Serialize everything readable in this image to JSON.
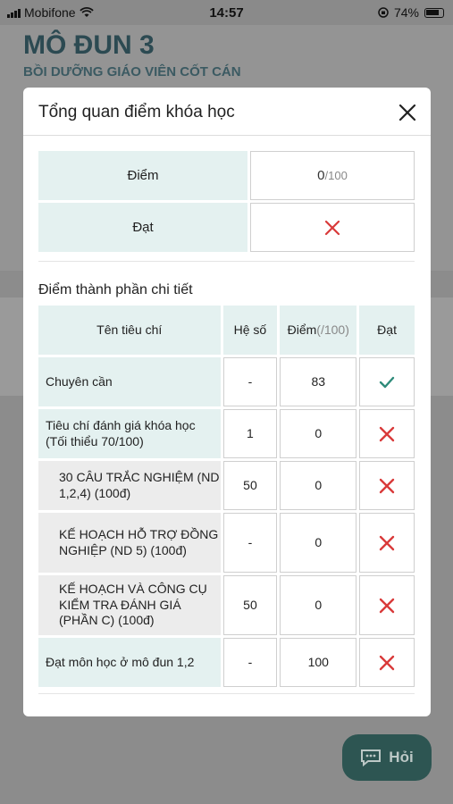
{
  "status_bar": {
    "carrier": "Mobifone",
    "time": "14:57",
    "battery": "74%"
  },
  "background": {
    "title": "MÔ ĐUN 3",
    "subtitle": "BỒI DƯỠNG GIÁO VIÊN CỐT CÁN",
    "chat_button": "Hỏi"
  },
  "modal": {
    "title": "Tổng quan điểm khóa học",
    "summary": {
      "score_label": "Điểm",
      "score_value": "0",
      "score_max": "/100",
      "pass_label": "Đạt",
      "pass_icon": "cross-icon"
    },
    "detail_title": "Điểm thành phần chi tiết",
    "columns": {
      "name": "Tên tiêu chí",
      "weight": "Hệ số",
      "score": "Điểm",
      "score_suffix": "(/100)",
      "pass": "Đạt"
    },
    "rows": [
      {
        "name": "Chuyên cần",
        "weight": "-",
        "score": "83",
        "pass": "check"
      },
      {
        "name": "Tiêu chí đánh giá khóa học (Tối thiểu 70/100)",
        "weight": "1",
        "score": "0",
        "pass": "cross"
      },
      {
        "name": "30 CÂU TRẮC NGHIỆM (ND 1,2,4) (100đ)",
        "weight": "50",
        "score": "0",
        "pass": "cross"
      },
      {
        "name": "KẾ HOẠCH HỖ TRỢ ĐỒNG NGHIỆP (ND 5) (100đ)",
        "weight": "-",
        "score": "0",
        "pass": "cross"
      },
      {
        "name": "KẾ HOẠCH VÀ CÔNG CỤ KIỂM TRA ĐÁNH GIÁ (PHẦN C) (100đ)",
        "weight": "50",
        "score": "0",
        "pass": "cross"
      },
      {
        "name": "Đạt môn học ở mô đun 1,2",
        "weight": "-",
        "score": "100",
        "pass": "cross"
      }
    ]
  },
  "colors": {
    "check": "#2e8b7a",
    "cross": "#d93a3a",
    "teal_bg": "#e4f1f0"
  }
}
